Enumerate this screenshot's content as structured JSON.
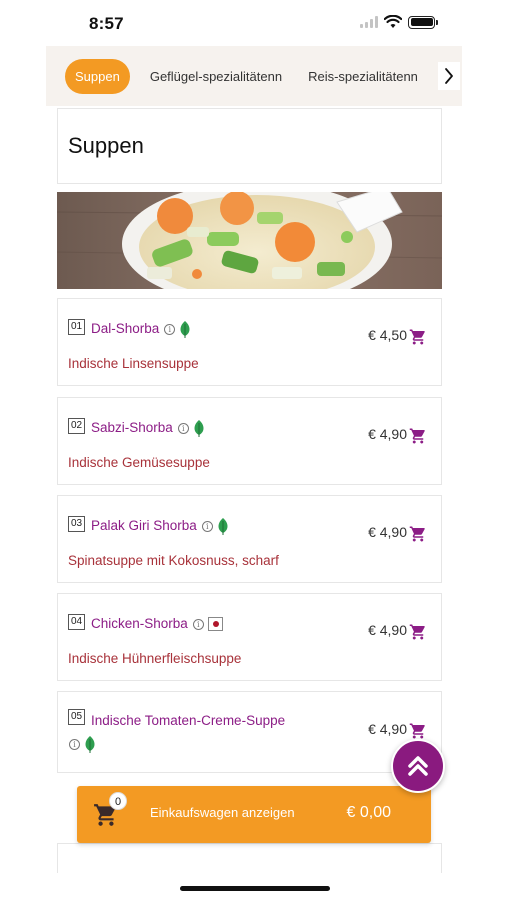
{
  "status_bar": {
    "time": "8:57"
  },
  "tabs": [
    {
      "label": "Suppen",
      "active": true
    },
    {
      "label": "Geflügel-spezialitätenn",
      "active": false
    },
    {
      "label": "Reis-spezialitätenn",
      "active": false
    }
  ],
  "section": {
    "title": "Suppen",
    "image_alt": "soup-bowl-image"
  },
  "items": [
    {
      "number": "01",
      "name": "Dal-Shorba",
      "tag": "leaf-icon",
      "description": "Indische Linsensuppe",
      "price": "€ 4,50"
    },
    {
      "number": "02",
      "name": "Sabzi-Shorba",
      "tag": "leaf-icon",
      "description": "Indische Gemüsesuppe",
      "price": "€ 4,90"
    },
    {
      "number": "03",
      "name": "Palak Giri Shorba",
      "tag": "leaf-icon",
      "description": "Spinatsuppe mit Kokosnuss, scharf",
      "price": "€ 4,90"
    },
    {
      "number": "04",
      "name": "Chicken-Shorba",
      "tag": "chicken-icon",
      "description": "Indische Hühnerfleischsuppe",
      "price": "€ 4,90"
    },
    {
      "number": "05",
      "name": "Indische Tomaten-Creme-Suppe",
      "tag": "leaf-icon",
      "description": "",
      "price": "€ 4,90"
    }
  ],
  "cart": {
    "count": "0",
    "label": "Einkaufswagen anzeigen",
    "total": "€ 0,00"
  },
  "colors": {
    "accent_orange": "#f39a23",
    "brand_purple": "#8c1d86",
    "desc_red": "#a8323a",
    "leaf_green": "#2e9e4f"
  }
}
